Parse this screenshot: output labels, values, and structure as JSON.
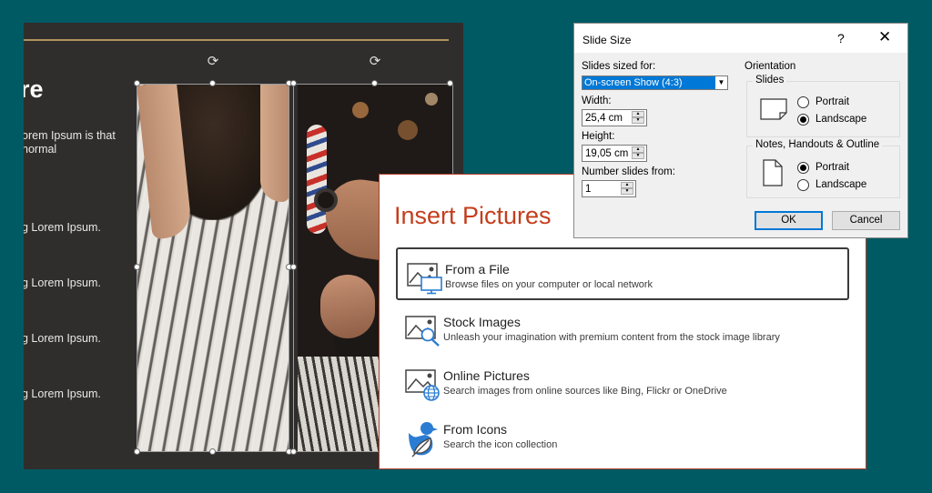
{
  "slide": {
    "title_fragment": "re",
    "paragraph": "orem Ipsum is that normal",
    "bullets": [
      "g Lorem Ipsum.",
      "g Lorem Ipsum.",
      "g Lorem Ipsum.",
      "g Lorem Ipsum."
    ]
  },
  "insert_pictures": {
    "heading": "Insert Pictures",
    "items": [
      {
        "label": "From a File",
        "desc": "Browse files on your computer or local network",
        "icon": "picture-computer-icon"
      },
      {
        "label": "Stock Images",
        "desc": "Unleash your imagination with premium content from the stock image library",
        "icon": "picture-search-icon"
      },
      {
        "label": "Online Pictures",
        "desc": "Search images from online sources like Bing, Flickr or OneDrive",
        "icon": "picture-globe-icon"
      },
      {
        "label": "From Icons",
        "desc": "Search the icon collection",
        "icon": "bird-leaf-icon"
      }
    ],
    "accent": "#c43e1c"
  },
  "slide_size_dialog": {
    "title": "Slide Size",
    "help": "?",
    "close": "✕",
    "sized_for_label": "Slides sized for:",
    "sized_for_value": "On-screen Show (4:3)",
    "width_label": "Width:",
    "width_value": "25,4 cm",
    "height_label": "Height:",
    "height_value": "19,05 cm",
    "number_from_label": "Number slides from:",
    "number_from_value": "1",
    "orientation_label": "Orientation",
    "slides_group": "Slides",
    "notes_group": "Notes, Handouts & Outline",
    "portrait": "Portrait",
    "landscape": "Landscape",
    "slides_orientation": "Landscape",
    "notes_orientation": "Portrait",
    "ok": "OK",
    "cancel": "Cancel",
    "highlight": "#0078d7"
  }
}
